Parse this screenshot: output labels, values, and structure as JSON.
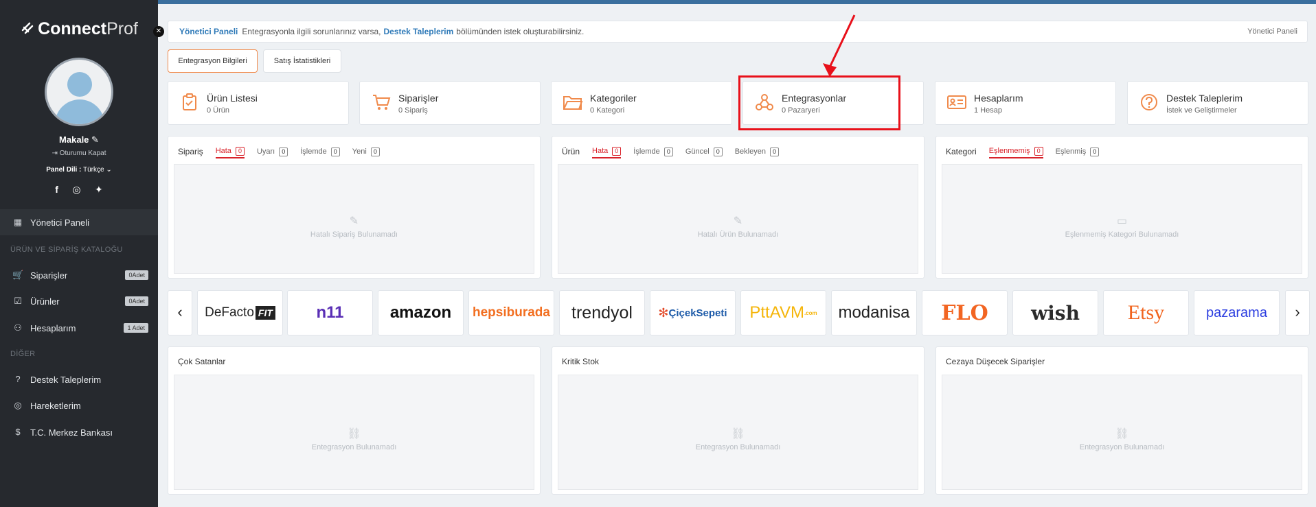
{
  "app": {
    "brand_bold": "Connect",
    "brand_light": "Prof"
  },
  "user": {
    "name": "Makale",
    "logout": "Oturumu Kapat",
    "lang_label": "Panel Dili :",
    "lang_value": "Türkçe"
  },
  "social": [
    {
      "icon": "facebook-icon",
      "glyph": "f"
    },
    {
      "icon": "instagram-icon",
      "glyph": "◎"
    },
    {
      "icon": "twitter-icon",
      "glyph": "🐦"
    }
  ],
  "sidebar": {
    "dashboard": "Yönetici Paneli",
    "section1": "ÜRÜN VE SİPARİŞ KATALOĞU",
    "orders": "Siparişler",
    "orders_badge": "0Adet",
    "products": "Ürünler",
    "products_badge": "0Adet",
    "accounts": "Hesaplarım",
    "accounts_badge": "1 Adet",
    "section2": "DİĞER",
    "support": "Destek Taleplerim",
    "activity": "Hareketlerim",
    "bank": "T.C. Merkez Bankası"
  },
  "notice": {
    "title": "Yönetici Paneli",
    "text1": "Entegrasyonla ilgili sorunlarınız varsa,",
    "link": "Destek Taleplerim",
    "text2": "bölümünden istek oluşturabilirsiniz.",
    "breadcrumb": "Yönetici Paneli"
  },
  "tabs": {
    "integration_info": "Entegrasyon Bilgileri",
    "sales_stats": "Satış İstatistikleri"
  },
  "cards": [
    {
      "title": "Ürün Listesi",
      "sub": "0 Ürün",
      "icon": "clipboard-icon",
      "glyph": "📋"
    },
    {
      "title": "Siparişler",
      "sub": "0 Sipariş",
      "icon": "cart-icon",
      "glyph": "🛒"
    },
    {
      "title": "Kategoriler",
      "sub": "0 Kategori",
      "icon": "folder-icon",
      "glyph": "📂"
    },
    {
      "title": "Entegrasyonlar",
      "sub": "0 Pazaryeri",
      "icon": "webhook-icon",
      "glyph": "⛓"
    },
    {
      "title": "Hesaplarım",
      "sub": "1 Hesap",
      "icon": "id-card-icon",
      "glyph": "🪪"
    },
    {
      "title": "Destek Taleplerim",
      "sub": "İstek ve Geliştirmeler",
      "icon": "question-icon",
      "glyph": "?"
    }
  ],
  "order_panel": {
    "title": "Sipariş",
    "tabs": [
      {
        "label": "Hata",
        "count": "0"
      },
      {
        "label": "Uyarı",
        "count": "0"
      },
      {
        "label": "İşlemde",
        "count": "0"
      },
      {
        "label": "Yeni",
        "count": "0"
      }
    ],
    "empty": "Hatalı Sipariş Bulunamadı"
  },
  "product_panel": {
    "title": "Ürün",
    "tabs": [
      {
        "label": "Hata",
        "count": "0"
      },
      {
        "label": "İşlemde",
        "count": "0"
      },
      {
        "label": "Güncel",
        "count": "0"
      },
      {
        "label": "Bekleyen",
        "count": "0"
      }
    ],
    "empty": "Hatalı Ürün Bulunamadı"
  },
  "category_panel": {
    "title": "Kategori",
    "tabs": [
      {
        "label": "Eşlenmemiş",
        "count": "0"
      },
      {
        "label": "Eşlenmiş",
        "count": "0"
      }
    ],
    "empty": "Eşlenmemiş Kategori Bulunamadı"
  },
  "marketplaces": [
    {
      "name": "DeFacto FIT",
      "a": "DeFacto",
      "b": "FIT",
      "color": "#222222"
    },
    {
      "name": "n11",
      "a": "n11",
      "b": "",
      "color": "#5a2fb5"
    },
    {
      "name": "amazon",
      "a": "amazon",
      "b": "",
      "color": "#111111"
    },
    {
      "name": "hepsiburada",
      "a": "hepsiburada",
      "b": "",
      "color": "#f26f21"
    },
    {
      "name": "trendyol",
      "a": "trendyol",
      "b": "",
      "color": "#222222"
    },
    {
      "name": "ÇiçekSepeti",
      "a": "ÇiçekSepeti",
      "b": "",
      "color": "#1c5aa8"
    },
    {
      "name": "PttAVM",
      "a": "PttAVM",
      "b": ".com",
      "color": "#f5b50a"
    },
    {
      "name": "modanisa",
      "a": "modanisa",
      "b": "",
      "color": "#222222"
    },
    {
      "name": "FLO",
      "a": "FLO",
      "b": "",
      "color": "#f26522"
    },
    {
      "name": "wish",
      "a": "wish",
      "b": "",
      "color": "#2b2b2b"
    },
    {
      "name": "Etsy",
      "a": "Etsy",
      "b": "",
      "color": "#f1641e"
    },
    {
      "name": "pazarama",
      "a": "pazarama",
      "b": "",
      "color": "#2c3ee0"
    }
  ],
  "bottom_panels": [
    {
      "title": "Çok Satanlar",
      "empty": "Entegrasyon Bulunamadı"
    },
    {
      "title": "Kritik Stok",
      "empty": "Entegrasyon Bulunamadı"
    },
    {
      "title": "Cezaya Düşecek Siparişler",
      "empty": "Entegrasyon Bulunamadı"
    }
  ],
  "colors": {
    "accent": "#f08a4b",
    "highlight": "#e8101a",
    "sidebar": "#26292e",
    "link": "#2f7ab8"
  }
}
